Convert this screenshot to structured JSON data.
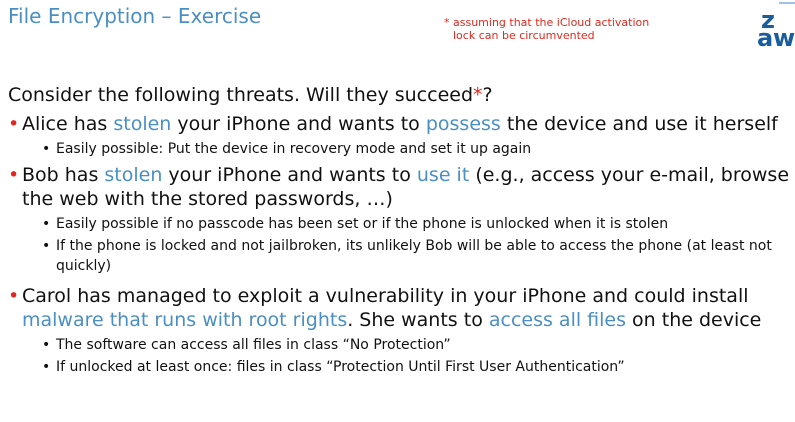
{
  "header": {
    "title": "File Encryption – Exercise",
    "footnote_line1": "* assuming that the iCloud activation",
    "footnote_line2": "lock can be circumvented"
  },
  "logo": {
    "text": "zh aw"
  },
  "intro": {
    "text": "Consider the following threats. Will they succeed",
    "star": "*",
    "suffix": "?"
  },
  "bullet_symbol": "•",
  "items": [
    {
      "parts": [
        "Alice has ",
        "stolen",
        " your iPhone and wants to ",
        "possess",
        " the device and use it herself"
      ],
      "subs": [
        "Easily possible: Put the device in recovery mode and set it up again"
      ]
    },
    {
      "parts": [
        "Bob has ",
        "stolen",
        " your iPhone and wants to ",
        "use it",
        " (e.g., access your e-mail, browse the web with the stored passwords, …)"
      ],
      "subs": [
        "Easily possible if no passcode has been set or if the phone is unlocked when it is stolen",
        "If the phone is locked and not jailbroken, its unlikely Bob will be able to access the phone (at least not quickly)"
      ]
    },
    {
      "parts": [
        "Carol has managed to exploit a vulnerability in your iPhone and could install ",
        "malware that runs with root rights",
        ". She wants to ",
        "access all files",
        " on the device"
      ],
      "subs": [
        "The software can access all files in class “No Protection”",
        "If unlocked at least once: files in class “Protection Until First User Authentication”"
      ]
    }
  ]
}
